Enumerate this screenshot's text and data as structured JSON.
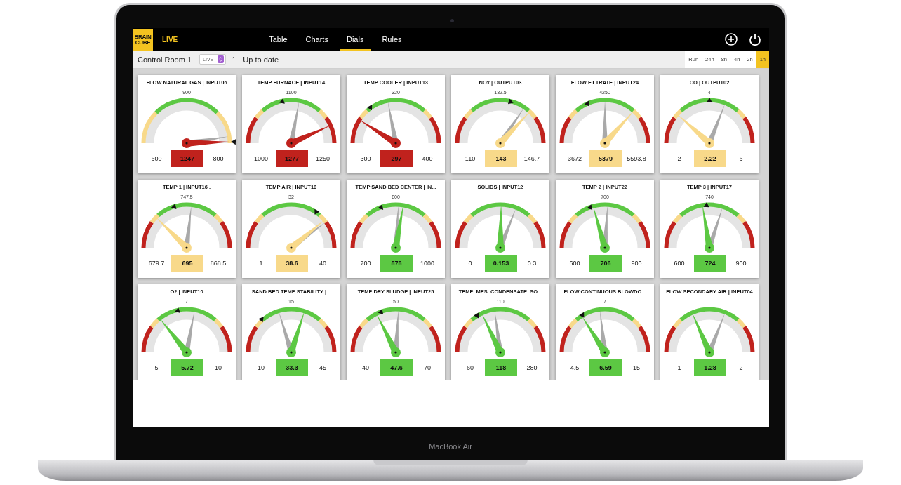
{
  "device_label": "MacBook Air",
  "header": {
    "logo": "BRAIN CUBE",
    "mode": "LIVE",
    "tabs": [
      {
        "label": "Table",
        "selected": false
      },
      {
        "label": "Charts",
        "selected": false
      },
      {
        "label": "Dials",
        "selected": true
      },
      {
        "label": "Rules",
        "selected": false
      }
    ]
  },
  "toolbar": {
    "room": "Control Room 1",
    "mode_select": "LIVE",
    "count": "1",
    "status": "Up to date",
    "ranges": [
      {
        "label": "Run",
        "selected": false
      },
      {
        "label": "24h",
        "selected": false
      },
      {
        "label": "8h",
        "selected": false
      },
      {
        "label": "4h",
        "selected": false
      },
      {
        "label": "2h",
        "selected": false
      },
      {
        "label": "1h",
        "selected": true
      }
    ]
  },
  "gauges": [
    {
      "title": "FLOW NATURAL GAS | INPUT06",
      "target": "900",
      "min": "600",
      "max": "800",
      "value": "1247",
      "color": "#c0221d",
      "kind": "three_zone"
    },
    {
      "title": "TEMP FURNACE | INPUT14",
      "target": "1100",
      "min": "1000",
      "max": "1250",
      "value": "1277",
      "color": "#c0221d",
      "kind": "five_zone"
    },
    {
      "title": "TEMP COOLER | INPUT13",
      "target": "320",
      "min": "300",
      "max": "400",
      "value": "297",
      "color": "#c0221d",
      "kind": "five_zone"
    },
    {
      "title": "NOx | OUTPUT03",
      "target": "132.5",
      "min": "110",
      "max": "146.7",
      "value": "143",
      "color": "#f8d98a",
      "kind": "five_zone"
    },
    {
      "title": "FLOW FILTRATE | INPUT24",
      "target": "4250",
      "min": "3672",
      "max": "5593.8",
      "value": "5379",
      "color": "#f8d98a",
      "kind": "five_zone"
    },
    {
      "title": "CO | OUTPUT02",
      "target": "4",
      "min": "2",
      "max": "6",
      "value": "2.22",
      "color": "#f8d98a",
      "kind": "five_zone"
    },
    {
      "title": "TEMP 1 | INPUT16 .",
      "target": "747.5",
      "min": "679.7",
      "max": "868.5",
      "value": "695",
      "color": "#f8d98a",
      "kind": "five_zone"
    },
    {
      "title": "TEMP AIR | INPUT18",
      "target": "32",
      "min": "1",
      "max": "40",
      "value": "38.6",
      "color": "#f8d98a",
      "kind": "five_zone"
    },
    {
      "title": "TEMP SAND BED CENTER | IN...",
      "target": "800",
      "min": "700",
      "max": "1000",
      "value": "878",
      "color": "#5cc843",
      "kind": "five_zone"
    },
    {
      "title": "SOLIDS | INPUT12",
      "min": "0",
      "max": "0.3",
      "value": "0.153",
      "color": "#5cc843",
      "kind": "five_zone"
    },
    {
      "title": "TEMP 2 | INPUT22",
      "target": "700",
      "min": "600",
      "max": "900",
      "value": "706",
      "color": "#5cc843",
      "kind": "five_zone"
    },
    {
      "title": "TEMP 3 | INPUT17",
      "target": "740",
      "min": "600",
      "max": "900",
      "value": "724",
      "color": "#5cc843",
      "kind": "five_zone"
    },
    {
      "title": "O2 | INPUT10",
      "target": "7",
      "min": "5",
      "max": "10",
      "value": "5.72",
      "color": "#5cc843",
      "kind": "five_zone"
    },
    {
      "title": "SAND BED TEMP STABILITY |...",
      "target": "15",
      "min": "10",
      "max": "45",
      "value": "33.3",
      "color": "#5cc843",
      "kind": "five_zone"
    },
    {
      "title": "TEMP DRY SLUDGE | INPUT25",
      "target": "50",
      "min": "40",
      "max": "70",
      "value": "47.6",
      "color": "#5cc843",
      "kind": "five_zone"
    },
    {
      "title": "TEMP  MES  CONDENSATE  SO...",
      "target": "110",
      "min": "60",
      "max": "280",
      "value": "118",
      "color": "#5cc843",
      "kind": "five_zone"
    },
    {
      "title": "FLOW CONTINUOUS BLOWDO...",
      "target": "7",
      "min": "4.5",
      "max": "15",
      "value": "6.59",
      "color": "#5cc843",
      "kind": "five_zone"
    },
    {
      "title": "FLOW SECONDARY AIR | INPUT04",
      "min": "1",
      "max": "2",
      "value": "1.28",
      "color": "#5cc843",
      "kind": "five_zone"
    }
  ]
}
